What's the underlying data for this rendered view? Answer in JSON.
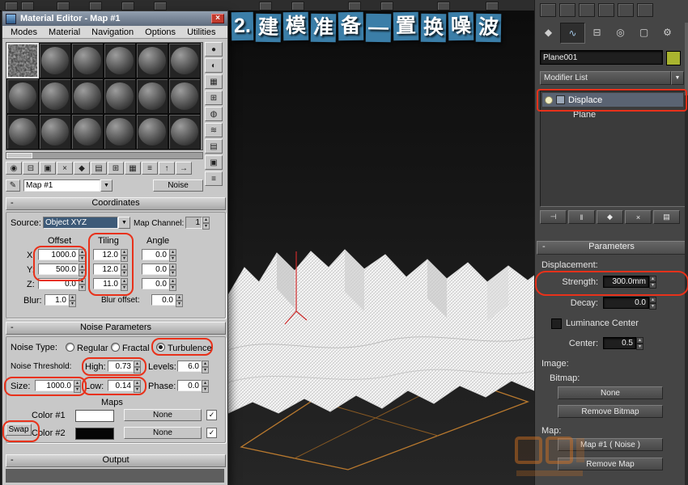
{
  "banner": {
    "chars": [
      "2.",
      "建",
      "模",
      "准",
      "备",
      "—",
      "置",
      "换",
      "噪",
      "波"
    ]
  },
  "ui": {
    "minus": "-",
    "dropdown_arrow": "▼",
    "spin_up": "▴",
    "spin_down": "▾",
    "check": "✓",
    "close": "×"
  },
  "material_editor": {
    "title": "Material Editor - Map #1",
    "menus": [
      "Modes",
      "Material",
      "Navigation",
      "Options",
      "Utilities"
    ],
    "sample_tools": [
      "●",
      "◐",
      "▦",
      "⊞",
      "◍",
      "≋",
      "▤",
      "▣",
      "≡"
    ],
    "toolbar": [
      "◉",
      "⊟",
      "▣",
      "×",
      "◆",
      "▤",
      "⊞",
      "▦",
      "≡",
      "↑",
      "→"
    ],
    "pick_button_glyph": "✎",
    "map_dropdown": "Map #1",
    "type_button": "Noise",
    "coordinates": {
      "header": "Coordinates",
      "source_label": "Source:",
      "source_value": "Object XYZ",
      "map_channel_label": "Map Channel:",
      "map_channel_value": "1",
      "columns": {
        "offset": "Offset",
        "tiling": "Tiling",
        "angle": "Angle"
      },
      "rows": [
        {
          "axis": "X:",
          "offset": "1000.0",
          "tiling": "12.0",
          "angle": "0.0"
        },
        {
          "axis": "Y:",
          "offset": "500.0",
          "tiling": "12.0",
          "angle": "0.0"
        },
        {
          "axis": "Z:",
          "offset": "0.0",
          "tiling": "11.0",
          "angle": "0.0"
        }
      ],
      "blur_label": "Blur:",
      "blur_value": "1.0",
      "blur_offset_label": "Blur offset:",
      "blur_offset_value": "0.0"
    },
    "noise": {
      "header": "Noise Parameters",
      "type_label": "Noise Type:",
      "types": [
        "Regular",
        "Fractal",
        "Turbulence"
      ],
      "selected_type": "Turbulence",
      "threshold_label": "Noise Threshold:",
      "high_label": "High:",
      "high_value": "0.73",
      "levels_label": "Levels:",
      "levels_value": "6.0",
      "size_label": "Size:",
      "size_value": "1000.0",
      "low_label": "Low:",
      "low_value": "0.14",
      "phase_label": "Phase:",
      "phase_value": "0.0",
      "maps_label": "Maps",
      "color1_label": "Color #1",
      "color2_label": "Color #2",
      "none_label": "None",
      "swap_label": "Swap"
    },
    "output_header": "Output"
  },
  "viewport": {
    "plane_outline_color": "#b9792e",
    "axis_color": "#cc2a2a"
  },
  "command_panel": {
    "tabs": [
      "◆",
      "∿",
      "⊟",
      "◎",
      "▢",
      "⚙"
    ],
    "object_name": "Plane001",
    "object_color": "#a9b42f",
    "modifier_list_label": "Modifier List",
    "stack": [
      {
        "label": "Displace"
      },
      {
        "label": "Plane"
      }
    ],
    "stack_tools": [
      "⊣",
      "‖",
      "◆",
      "×",
      "▤"
    ],
    "parameters": {
      "header": "Parameters",
      "displacement_label": "Displacement:",
      "strength_label": "Strength:",
      "strength_value": "300.0mm",
      "decay_label": "Decay:",
      "decay_value": "0.0",
      "luminance_label": "Luminance Center",
      "center_label": "Center:",
      "center_value": "0.5",
      "image_label": "Image:",
      "bitmap_label": "Bitmap:",
      "bitmap_none": "None",
      "remove_bitmap": "Remove Bitmap",
      "map_label": "Map:",
      "map_button": "Map #1 ( Noise )",
      "remove_map": "Remove Map"
    }
  }
}
